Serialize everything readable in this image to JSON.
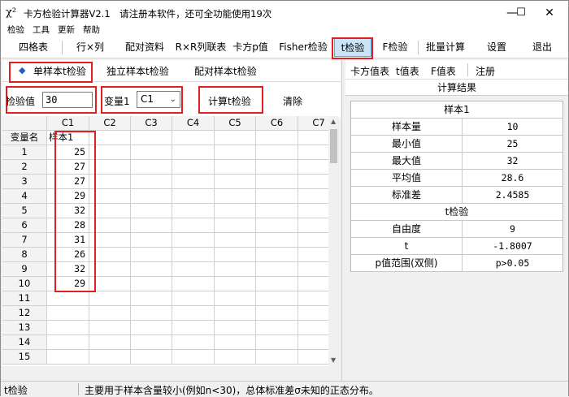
{
  "window": {
    "app_icon": "χ²",
    "title": "卡方检验计算器V2.1　请注册本软件，还可全功能使用19次",
    "minimize": "—",
    "maximize": "☐",
    "close": "✕"
  },
  "menu": [
    "检验",
    "工具",
    "更新",
    "帮助"
  ],
  "toolbar": [
    "四格表",
    "行×列",
    "配对资料",
    "R×R列联表",
    "卡方p值",
    "Fisher检验",
    "t检验",
    "F检验",
    "批量计算",
    "设置",
    "退出"
  ],
  "left_tabs": {
    "diamond": "◆",
    "one_sample": "单样本t检验",
    "independent": "独立样本t检验",
    "paired": "配对样本t检验"
  },
  "controls": {
    "test_value_label": "检验值",
    "test_value": "30",
    "variable_label": "变量1",
    "variable_value": "C1",
    "compute_button": "计算t检验",
    "clear_button": "清除"
  },
  "grid": {
    "corner": "",
    "columns": [
      "C1",
      "C2",
      "C3",
      "C4",
      "C5",
      "C6",
      "C7"
    ],
    "var_row_label": "变量名",
    "var_name": "样本1",
    "row_numbers": [
      "1",
      "2",
      "3",
      "4",
      "5",
      "6",
      "7",
      "8",
      "9",
      "10",
      "11",
      "12",
      "13",
      "14",
      "15"
    ],
    "values": [
      "25",
      "27",
      "27",
      "29",
      "32",
      "28",
      "31",
      "26",
      "32",
      "29"
    ]
  },
  "right_tabs": [
    "卡方值表",
    "t值表",
    "F值表",
    "注册"
  ],
  "results": {
    "title": "计算结果",
    "sample_section": "样本1",
    "sample_rows": [
      {
        "k": "样本量",
        "v": "10"
      },
      {
        "k": "最小值",
        "v": "25"
      },
      {
        "k": "最大值",
        "v": "32"
      },
      {
        "k": "平均值",
        "v": "28.6"
      },
      {
        "k": "标准差",
        "v": "2.4585"
      }
    ],
    "t_section": "t检验",
    "t_rows": [
      {
        "k": "自由度",
        "v": "9"
      },
      {
        "k": "t",
        "v": "-1.8007"
      },
      {
        "k": "p值范围(双侧)",
        "v": "p>0.05"
      }
    ]
  },
  "status": {
    "left": "t检验",
    "message": "主要用于样本含量较小(例如n<30)，总体标准差σ未知的正态分布。"
  }
}
